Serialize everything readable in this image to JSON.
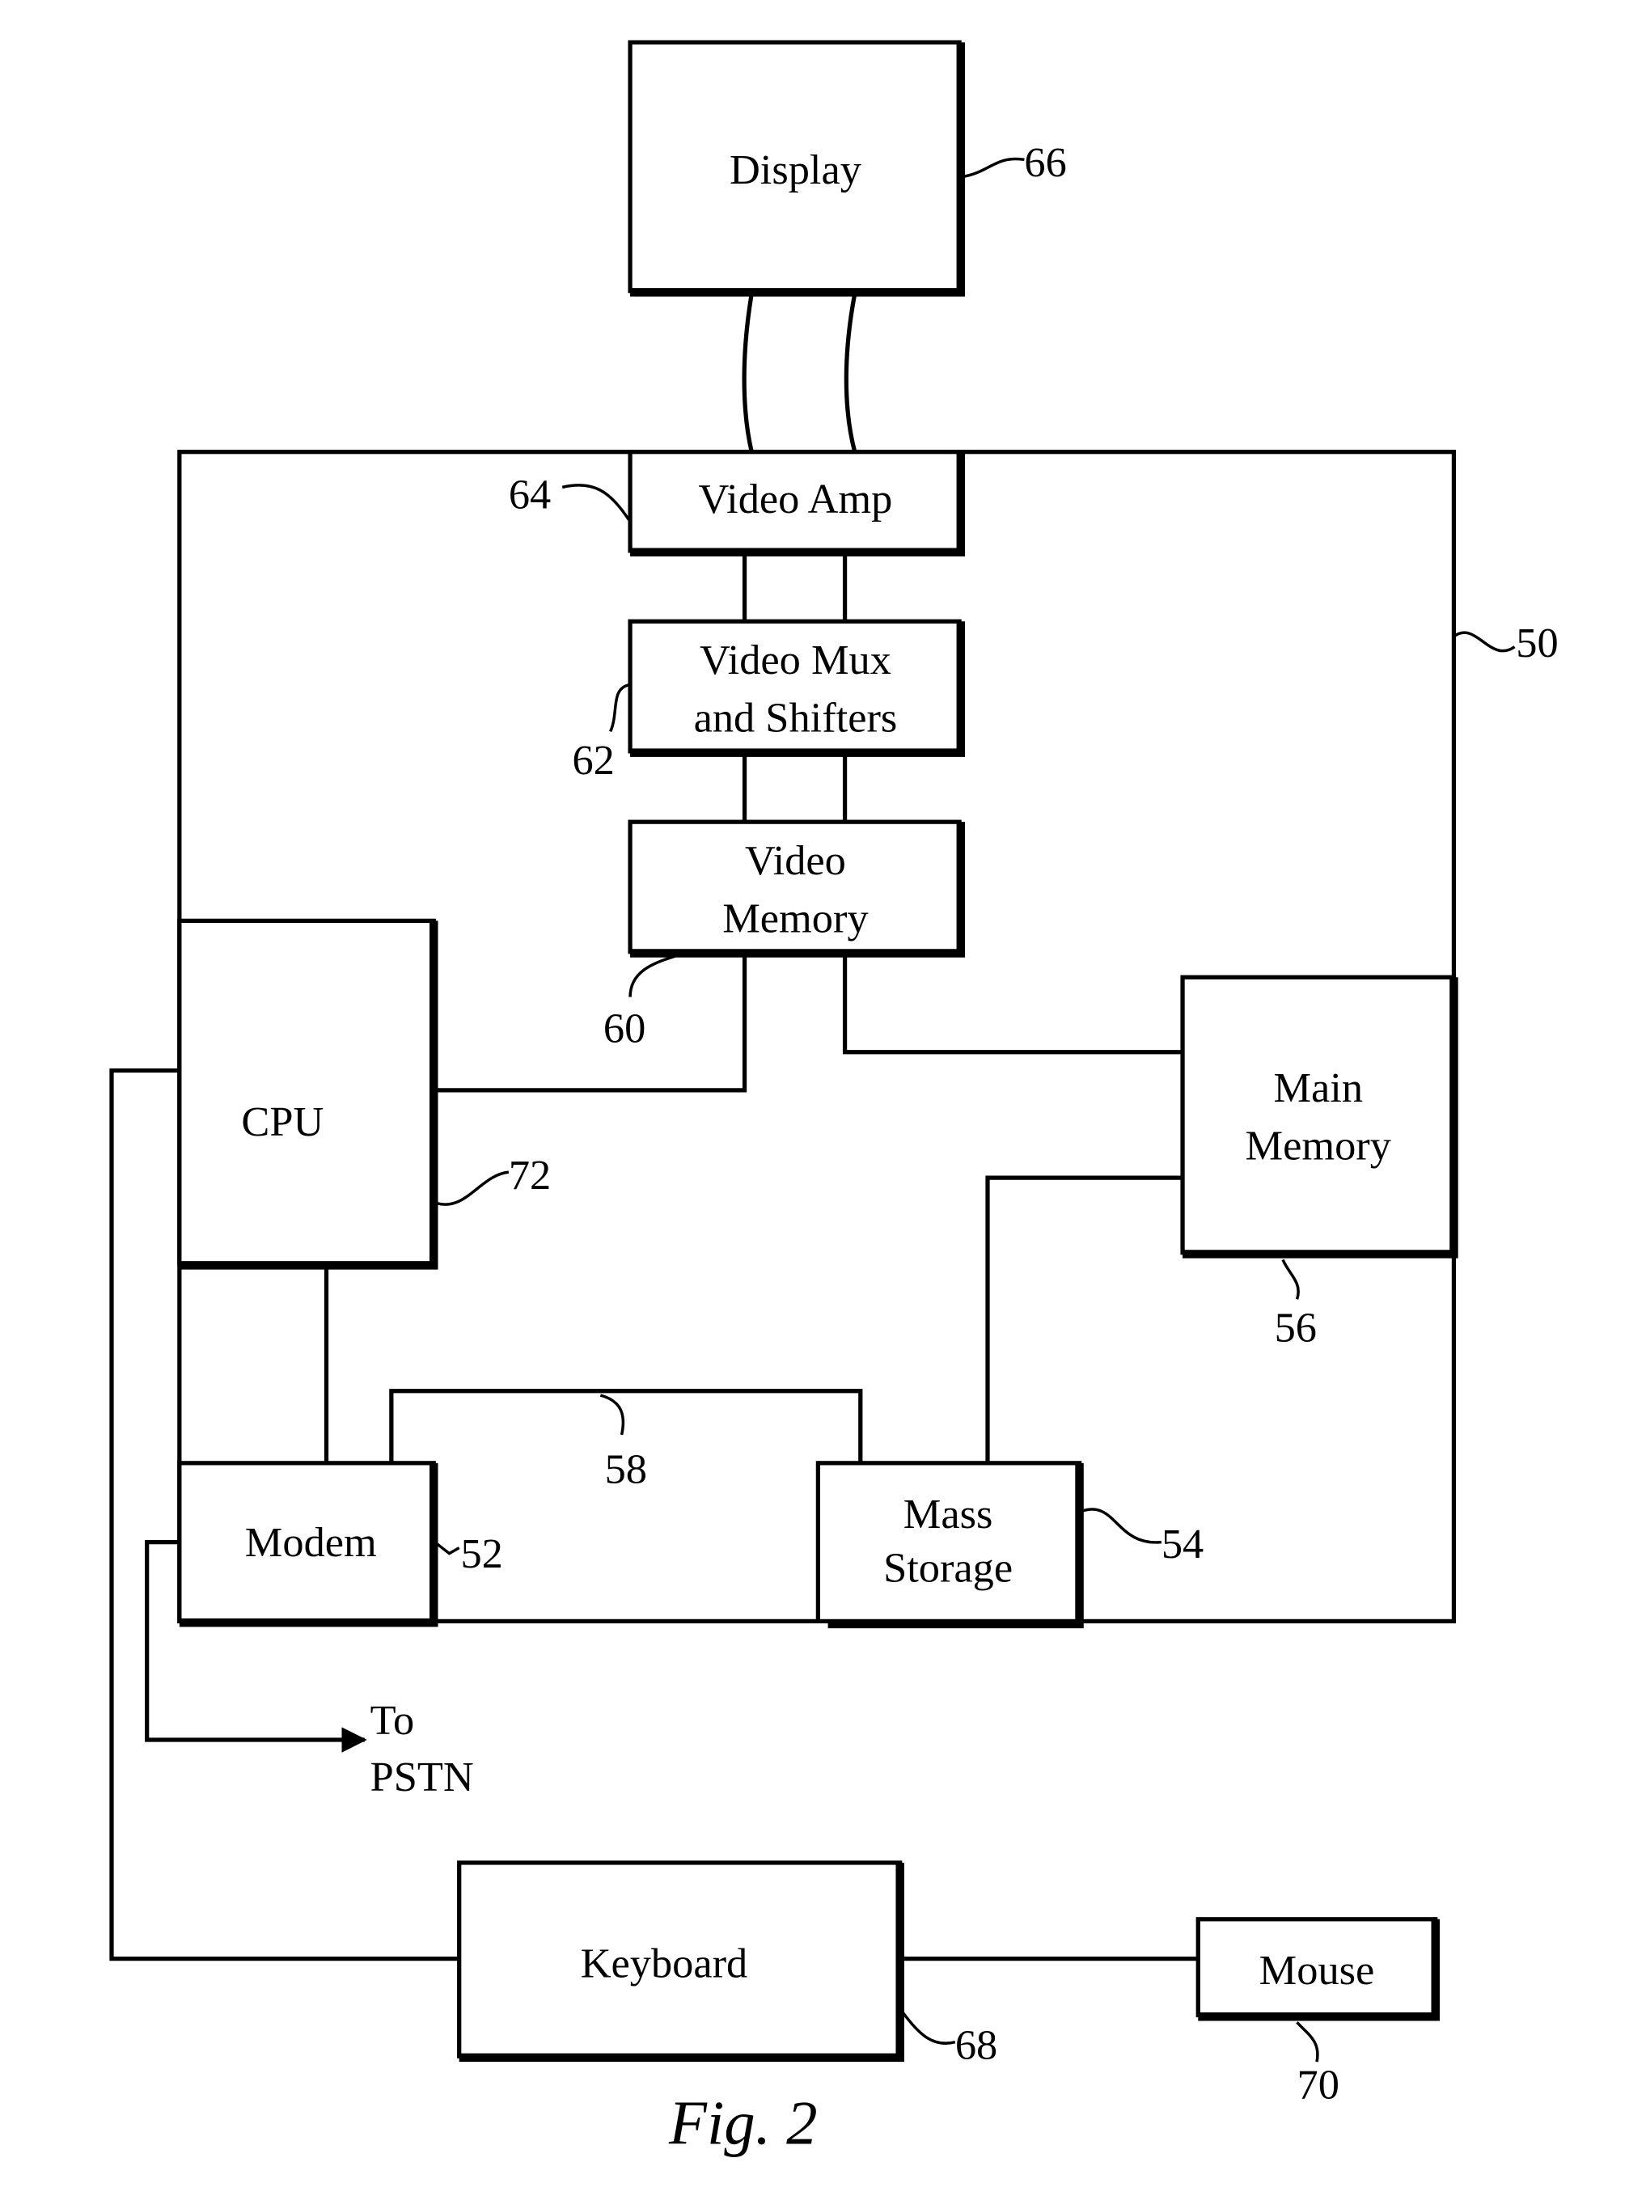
{
  "figure": {
    "caption": "Fig. 2"
  },
  "system": {
    "ref": "50"
  },
  "blocks": {
    "display": {
      "label": "Display",
      "ref": "66"
    },
    "video_amp": {
      "label": "Video Amp",
      "ref": "64"
    },
    "video_mux": {
      "line1": "Video Mux",
      "line2": "and Shifters",
      "ref": "62"
    },
    "video_memory": {
      "line1": "Video",
      "line2": "Memory",
      "ref": "60"
    },
    "cpu": {
      "label": "CPU",
      "ref": "72"
    },
    "main_memory": {
      "line1": "Main",
      "line2": "Memory",
      "ref": "56"
    },
    "modem": {
      "label": "Modem",
      "ref": "52"
    },
    "mass_storage": {
      "line1": "Mass",
      "line2": "Storage",
      "ref": "54"
    },
    "keyboard": {
      "label": "Keyboard",
      "ref": "68"
    },
    "mouse": {
      "label": "Mouse",
      "ref": "70"
    }
  },
  "bus": {
    "ref": "58"
  },
  "external": {
    "line1": "To",
    "line2": "PSTN"
  }
}
